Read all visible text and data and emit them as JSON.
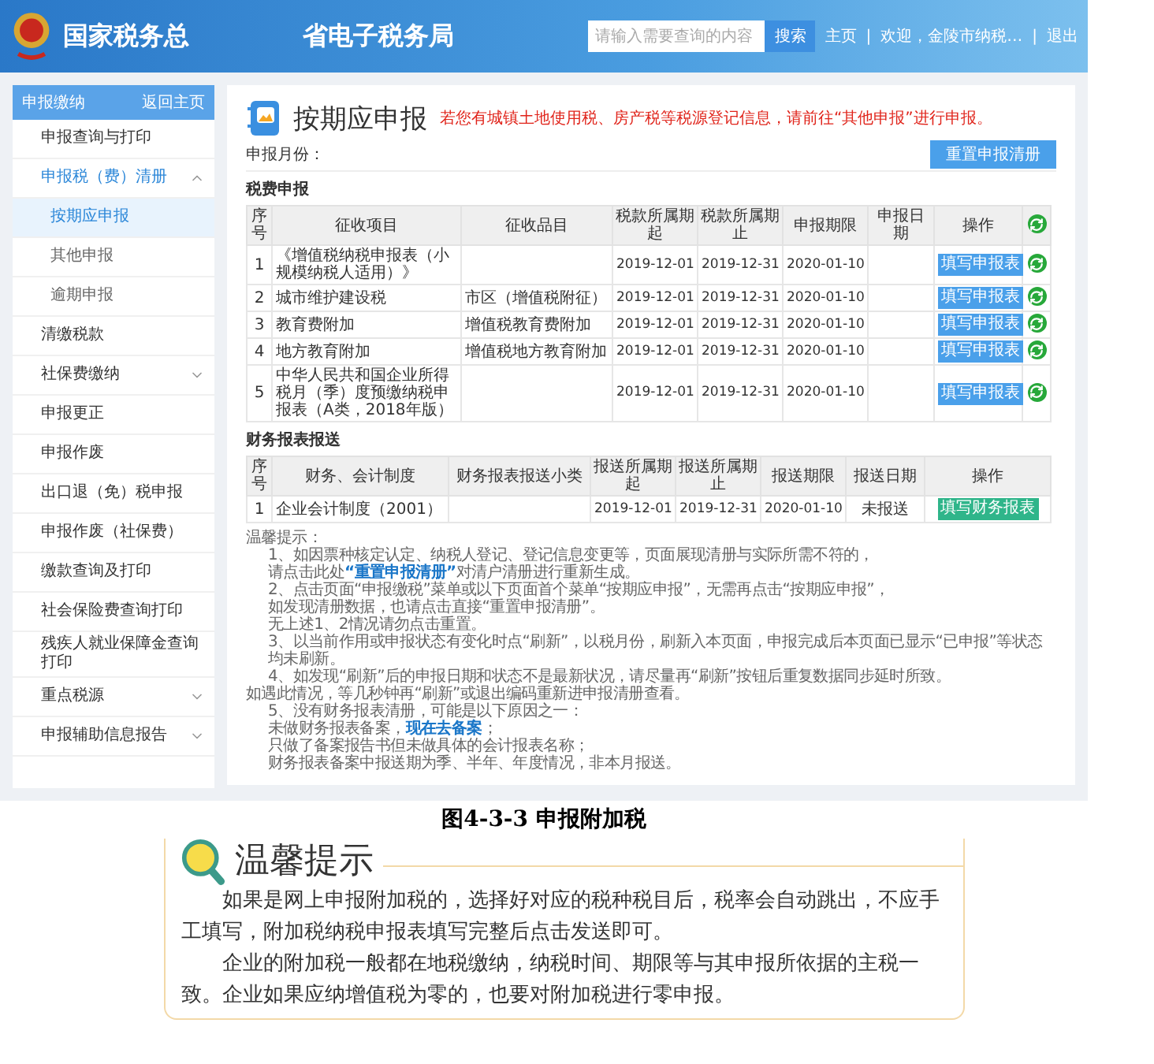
{
  "header": {
    "title_parts": [
      "国家税务总",
      "省电子税务局"
    ],
    "search": {
      "placeholder": "请输入需要查询的内容",
      "button": "搜索"
    },
    "links": [
      "主页",
      "欢迎，金陵市纳税…",
      "退出"
    ],
    "separator": "|"
  },
  "sidebar": {
    "title": "申报缴纳",
    "back": "返回主页",
    "items": [
      {
        "label": "申报查询与打印",
        "selected": false
      },
      {
        "label": "申报税（费）清册",
        "selected": false,
        "expanded": true,
        "children": [
          {
            "label": "按期应申报",
            "selected": true
          },
          {
            "label": "其他申报",
            "selected": false
          },
          {
            "label": "逾期申报",
            "selected": false
          }
        ]
      },
      {
        "label": "清缴税款",
        "selected": false
      },
      {
        "label": "社保费缴纳",
        "selected": false,
        "expanded": false
      },
      {
        "label": "申报更正",
        "selected": false
      },
      {
        "label": "申报作废",
        "selected": false
      },
      {
        "label": "出口退（免）税申报",
        "selected": false
      },
      {
        "label": "申报作废（社保费）",
        "selected": false
      },
      {
        "label": "缴款查询及打印",
        "selected": false
      },
      {
        "label": "社会保险费查询打印",
        "selected": false
      },
      {
        "label": "残疾人就业保障金查询打印",
        "selected": false
      },
      {
        "label": "重点税源",
        "selected": false,
        "expanded": false
      },
      {
        "label": "申报辅助信息报告",
        "selected": false,
        "expanded": false
      }
    ]
  },
  "main": {
    "title": "按期应申报",
    "notice": "若您有城镇土地使用税、房产税等税源登记信息，请前往“其他申报”进行申报。",
    "month_label": "申报月份：",
    "reset_button": "重置申报清册",
    "tax_section": {
      "title": "税费申报",
      "columns": [
        "序号",
        "征收项目",
        "征收品目",
        "税款所属期起",
        "税款所属期止",
        "申报期限",
        "申报日期",
        "操作"
      ],
      "rows": [
        {
          "no": "1",
          "item": "《增值税纳税申报表（小规模纳税人适用）》",
          "sub": "",
          "start": "2019-12-01",
          "end": "2019-12-31",
          "deadline": "2020-01-10",
          "date": "",
          "action": "填写申报表"
        },
        {
          "no": "2",
          "item": "城市维护建设税",
          "sub": "市区（增值税附征）",
          "start": "2019-12-01",
          "end": "2019-12-31",
          "deadline": "2020-01-10",
          "date": "",
          "action": "填写申报表"
        },
        {
          "no": "3",
          "item": "教育费附加",
          "sub": "增值税教育费附加",
          "start": "2019-12-01",
          "end": "2019-12-31",
          "deadline": "2020-01-10",
          "date": "",
          "action": "填写申报表"
        },
        {
          "no": "4",
          "item": "地方教育附加",
          "sub": "增值税地方教育附加",
          "start": "2019-12-01",
          "end": "2019-12-31",
          "deadline": "2020-01-10",
          "date": "",
          "action": "填写申报表"
        },
        {
          "no": "5",
          "item": "中华人民共和国企业所得税月（季）度预缴纳税申报表（A类，2018年版）",
          "sub": "",
          "start": "2019-12-01",
          "end": "2019-12-31",
          "deadline": "2020-01-10",
          "date": "",
          "action": "填写申报表"
        }
      ]
    },
    "finance_section": {
      "title": "财务报表报送",
      "columns": [
        "序号",
        "财务、会计制度",
        "财务报表报送小类",
        "报送所属期起",
        "报送所属期止",
        "报送期限",
        "报送日期",
        "操作"
      ],
      "rows": [
        {
          "no": "1",
          "item": "企业会计制度（2001）",
          "sub": "",
          "start": "2019-12-01",
          "end": "2019-12-31",
          "deadline": "2020-01-10",
          "date": "未报送",
          "action": "填写财务报表"
        }
      ]
    },
    "tips": {
      "title": "温馨提示：",
      "lines": [
        {
          "indent": true,
          "before": "1、如因票种核定认定、纳税人登记、登记信息变更等，页面展现清册与实际所需不符的，"
        },
        {
          "indent": true,
          "before": "请点击此处",
          "link": "“重置申报清册”",
          "after": "对清户清册进行重新生成。"
        },
        {
          "indent": true,
          "before": "2、点击页面“申报缴税”菜单或以下页面首个菜单“按期应申报”，无需再点击“按期应申报”，"
        },
        {
          "indent": true,
          "before": "如发现清册数据，也请点击直接“重置申报清册”。"
        },
        {
          "indent": true,
          "before": "无上述1、2情况请勿点击重置。"
        },
        {
          "indent": true,
          "before": "3、以当前作用或申报状态有变化时点“刷新”，以税月份，刷新入本页面，申报完成后本页面已显示“已申报”等状态均未刷新。"
        },
        {
          "indent": true,
          "before": "4、如发现“刷新”后的申报日期和状态不是最新状况，请尽量再“刷新”按钮后重复数据同步延时所致。"
        },
        {
          "indent": false,
          "before": "如遇此情况，等几秒钟再“刷新”或退出编码重新进申报清册查看。"
        },
        {
          "indent": true,
          "before": "5、没有财务报表清册，可能是以下原因之一："
        },
        {
          "indent": true,
          "before": "未做财务报表备案，",
          "link": "现在去备案",
          "after": "；"
        },
        {
          "indent": true,
          "before": "只做了备案报告书但未做具体的会计报表名称；"
        },
        {
          "indent": true,
          "before": "财务报表备案中报送期为季、半年、年度情况，非本月报送。"
        }
      ]
    }
  },
  "caption": "图4-3-3  申报附加税",
  "tip_box": {
    "title": "温馨提示",
    "paragraphs": [
      "如果是网上申报附加税的，选择好对应的税种税目后，税率会自动跳出，不应手工填写，附加税纳税申报表填写完整后点击发送即可。",
      "企业的附加税一般都在地税缴纳，纳税时间、期限等与其申报所依据的主税一致。企业如果应纳增值税为零的，也要对附加税进行零申报。"
    ]
  }
}
